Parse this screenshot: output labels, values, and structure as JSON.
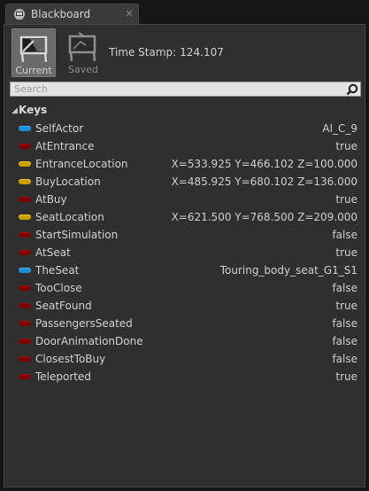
{
  "tab": {
    "title": "Blackboard",
    "close_glyph": "×",
    "icon": "blackboard-icon"
  },
  "modes": [
    {
      "label": "Current",
      "icon": "monitor-current-icon",
      "active": true
    },
    {
      "label": "Saved",
      "icon": "monitor-saved-icon",
      "active": false
    }
  ],
  "timestamp": {
    "label": "Time Stamp:",
    "value": "124.107"
  },
  "search": {
    "placeholder": "Search",
    "value": "",
    "icon": "search-icon"
  },
  "keys_section": {
    "title": "Keys",
    "expanded": true
  },
  "keys": [
    {
      "name": "SelfActor",
      "value": "AI_C_9",
      "type": "object"
    },
    {
      "name": "AtEntrance",
      "value": "true",
      "type": "bool"
    },
    {
      "name": "EntranceLocation",
      "value": "X=533.925 Y=466.102 Z=100.000",
      "type": "vector"
    },
    {
      "name": "BuyLocation",
      "value": "X=485.925 Y=680.102 Z=136.000",
      "type": "vector"
    },
    {
      "name": "AtBuy",
      "value": "true",
      "type": "bool"
    },
    {
      "name": "SeatLocation",
      "value": "X=621.500 Y=768.500 Z=209.000",
      "type": "vector"
    },
    {
      "name": "StartSimulation",
      "value": "false",
      "type": "bool"
    },
    {
      "name": "AtSeat",
      "value": "true",
      "type": "bool"
    },
    {
      "name": "TheSeat",
      "value": "Touring_body_seat_G1_S1",
      "type": "object"
    },
    {
      "name": "TooClose",
      "value": "false",
      "type": "bool"
    },
    {
      "name": "SeatFound",
      "value": "true",
      "type": "bool"
    },
    {
      "name": "PassengersSeated",
      "value": "false",
      "type": "bool"
    },
    {
      "name": "DoorAnimationDone",
      "value": "false",
      "type": "bool"
    },
    {
      "name": "ClosestToBuy",
      "value": "false",
      "type": "bool"
    },
    {
      "name": "Teleported",
      "value": "true",
      "type": "bool"
    }
  ],
  "colors": {
    "bool": "#7a0000",
    "vector": "#c8a000",
    "object": "#1d8fd6",
    "panel_bg": "#2f2f2f",
    "tab_bg": "#3a3a3a"
  }
}
